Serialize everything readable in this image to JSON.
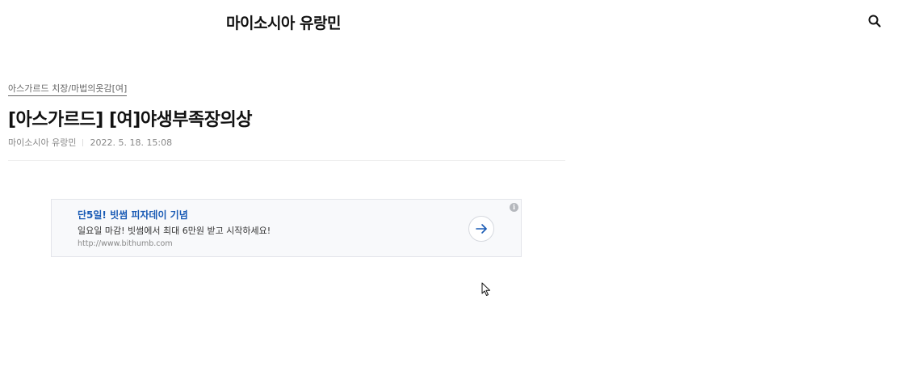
{
  "header": {
    "blog_title": "마이소시아 유랑민",
    "search_icon": "search-icon"
  },
  "post": {
    "category": "아스가르드 치장/마법의옷감[여]",
    "title": "[아스가르드] [여]야생부족장의상",
    "author": "마이소시아 유랑민",
    "date": "2022. 5. 18. 15:08"
  },
  "ad": {
    "headline": "단5일! 빗썸 피자데이 기념",
    "description": "일요일 마감! 빗썸에서 최대 6만원 받고 시작하세요!",
    "url": "http://www.bithumb.com",
    "arrow_icon": "arrow-right-icon",
    "info_icon": "info-icon",
    "info_glyph": "i",
    "headline_color": "#1a5bb5"
  }
}
